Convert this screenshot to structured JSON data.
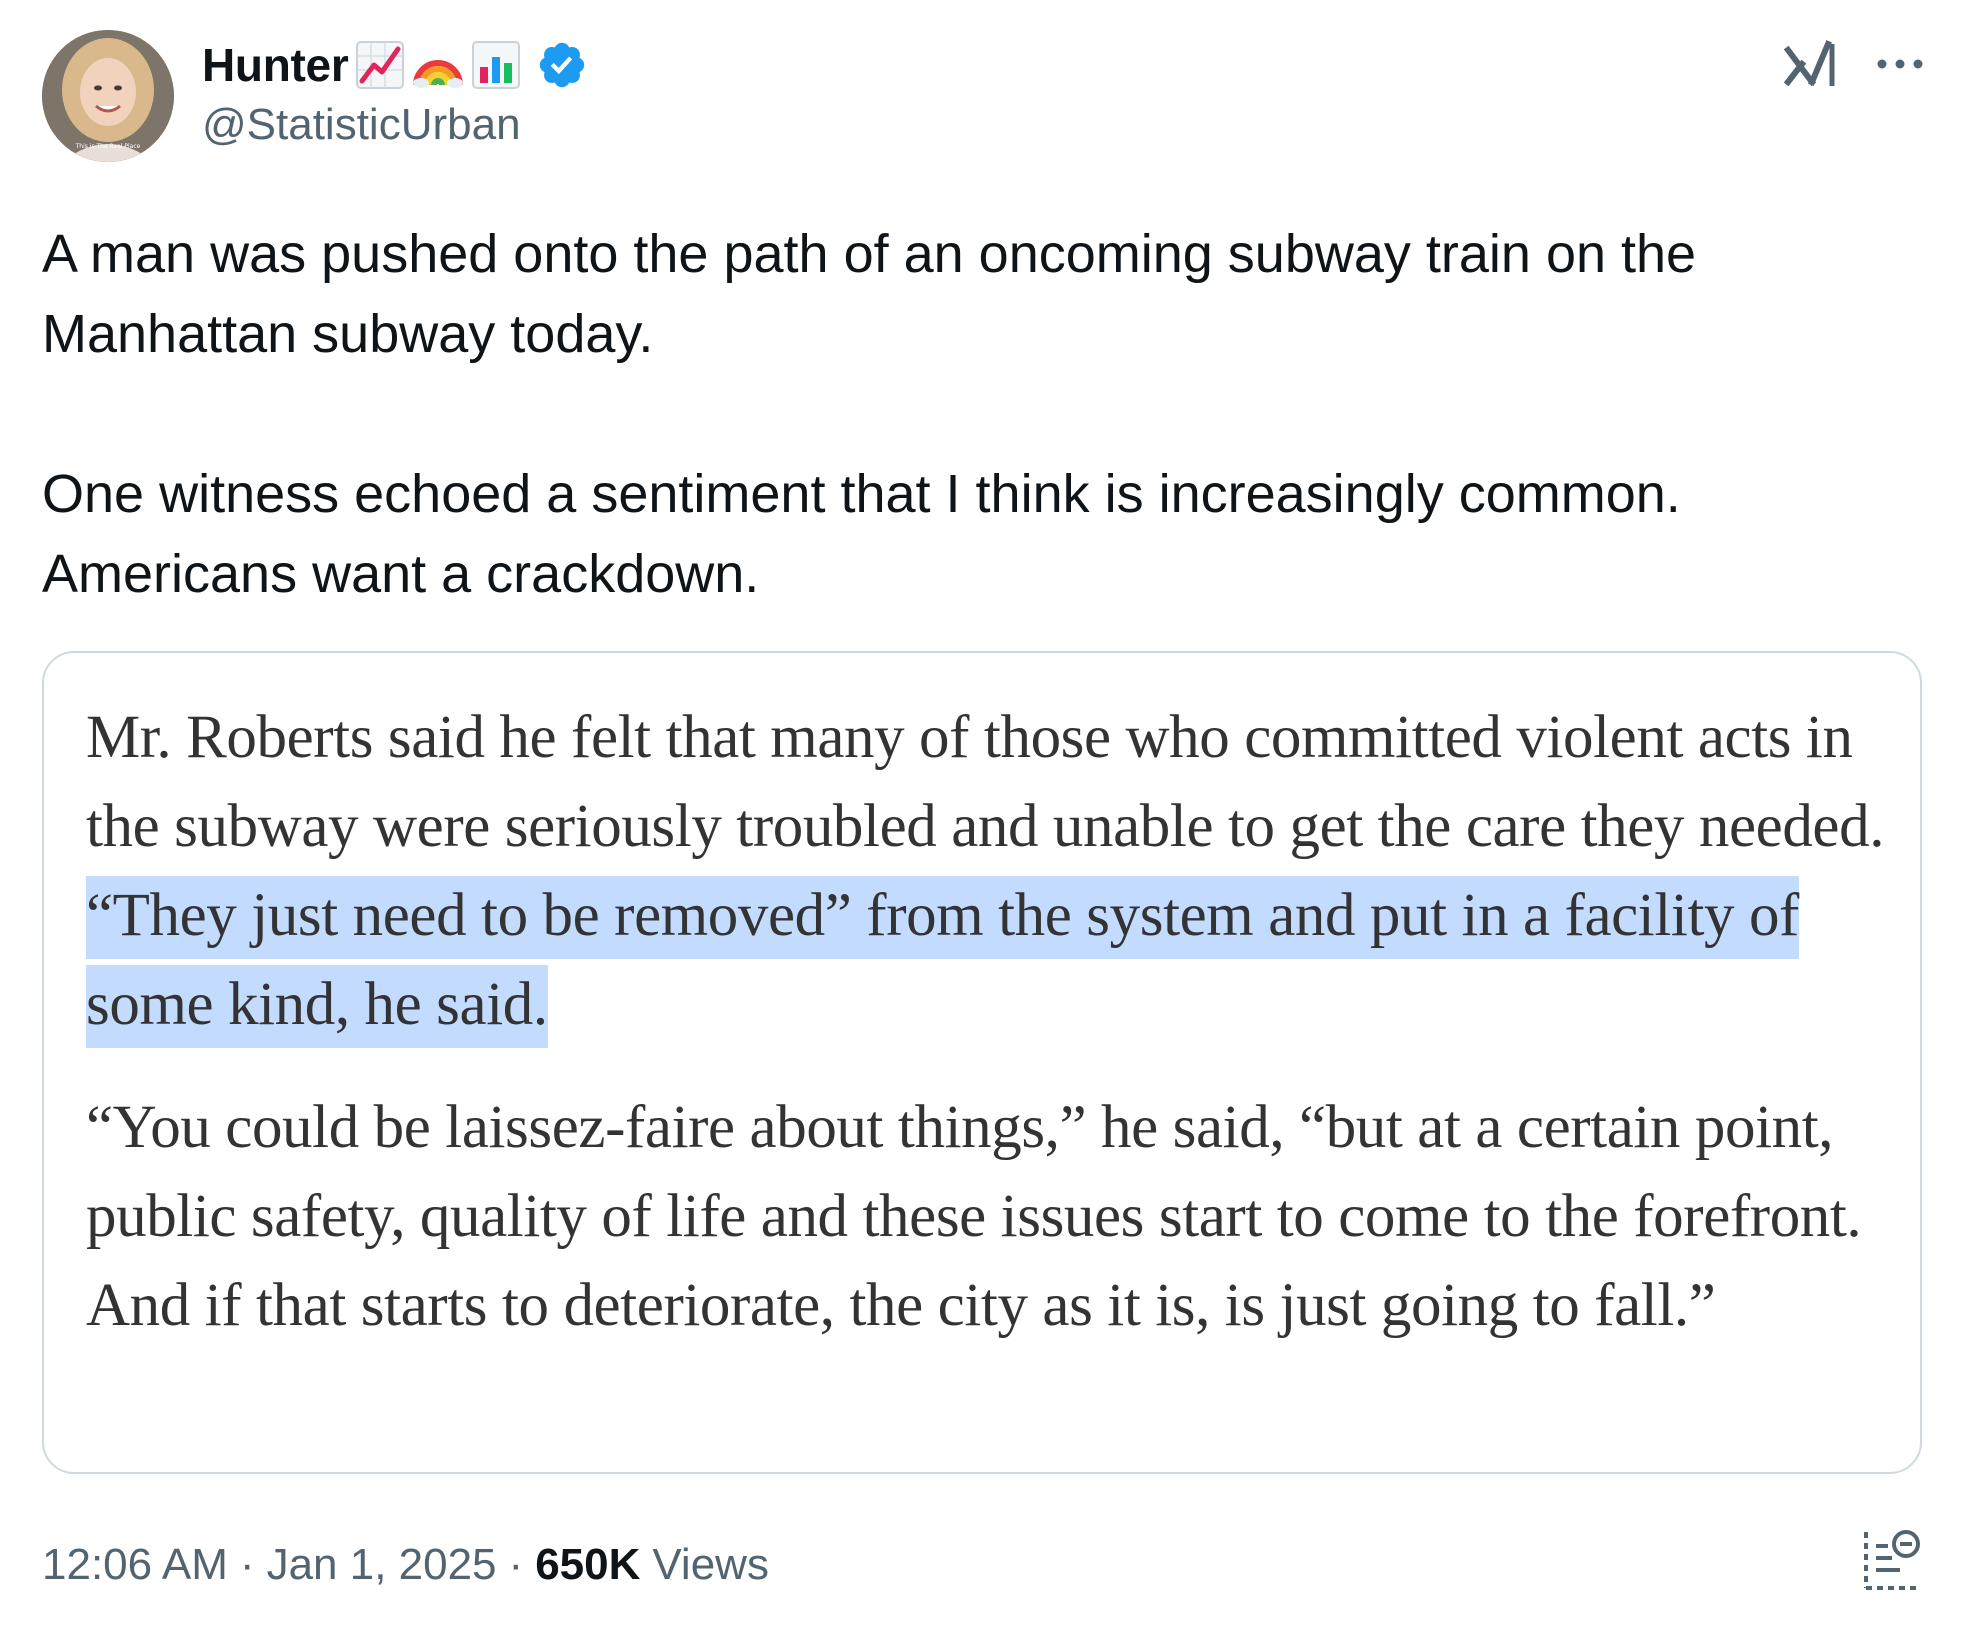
{
  "author": {
    "display_name": "Hunter",
    "handle": "@StatisticUrban",
    "name_emojis": [
      "chart-increasing-emoji",
      "rainbow-emoji",
      "bar-chart-emoji"
    ],
    "verified": true,
    "avatar_caption": "This is The Real Place"
  },
  "tweet": {
    "paragraphs": [
      "A man was pushed onto the path of an oncoming subway train on the Manhattan subway today.",
      "One witness echoed a sentiment that I think is increasingly common. Americans want a crackdown."
    ]
  },
  "media": {
    "paragraph1_before": "Mr. Roberts said he felt that many of those who committed violent acts in the subway were seriously troubled and unable to get the care they needed. ",
    "paragraph1_highlight": "“They just need to be removed” from the system and put in a facility of some kind, he said.",
    "paragraph2": "“You could be laissez-faire about things,” he said, “but at a certain point, public safety, quality of life and these issues start to come to the forefront. And if that starts to deteriorate, the city as it is, is just going to fall.”"
  },
  "meta": {
    "time": "12:06 AM",
    "separator": "·",
    "date": "Jan 1, 2025",
    "views_count": "650K",
    "views_label": "Views"
  },
  "icons": {
    "grok": "grok-icon",
    "more": "more-icon",
    "verified": "verified-badge-icon",
    "analytics": "analytics-icon"
  },
  "colors": {
    "text_primary": "#0f1419",
    "text_secondary": "#536471",
    "verified_blue": "#1d9bf0",
    "highlight": "#c3dbff",
    "card_border": "#cfd9de"
  }
}
